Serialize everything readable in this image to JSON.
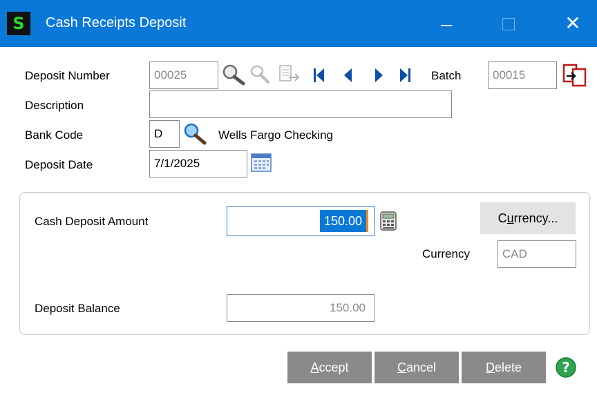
{
  "window": {
    "title": "Cash Receipts Deposit",
    "app_icon_letter": "S",
    "close_glyph": "✕"
  },
  "header": {
    "deposit_number_label": "Deposit Number",
    "deposit_number": "00025",
    "batch_label": "Batch",
    "batch": "00015",
    "description_label": "Description",
    "description": "",
    "bank_code_label": "Bank Code",
    "bank_code": "D",
    "bank_name": "Wells Fargo Checking",
    "deposit_date_label": "Deposit Date",
    "deposit_date": "7/1/2025"
  },
  "deposit": {
    "cash_amount_label": "Cash Deposit Amount",
    "cash_amount": "150.00",
    "currency_button": {
      "before": "C",
      "accel": "u",
      "after": "rrency..."
    },
    "currency_label": "Currency",
    "currency": "CAD",
    "balance_label": "Deposit Balance",
    "balance": "150.00"
  },
  "footer": {
    "accept": {
      "accel": "A",
      "rest": "ccept"
    },
    "cancel": {
      "accel": "C",
      "rest": "ancel"
    },
    "delete": {
      "accel": "D",
      "rest": "elete"
    },
    "help_glyph": "?"
  },
  "colors": {
    "titlebar": "#0a78d7",
    "button_gray": "#8a8a8a",
    "selection": "#0a78d7",
    "help_green": "#2da44e"
  },
  "icons": [
    "search-icon",
    "zoom-icon",
    "merge-icon",
    "document-icon",
    "first-record-icon",
    "previous-record-icon",
    "next-record-icon",
    "last-record-icon",
    "copy-from-icon",
    "calendar-icon",
    "calculator-icon",
    "help-icon"
  ]
}
